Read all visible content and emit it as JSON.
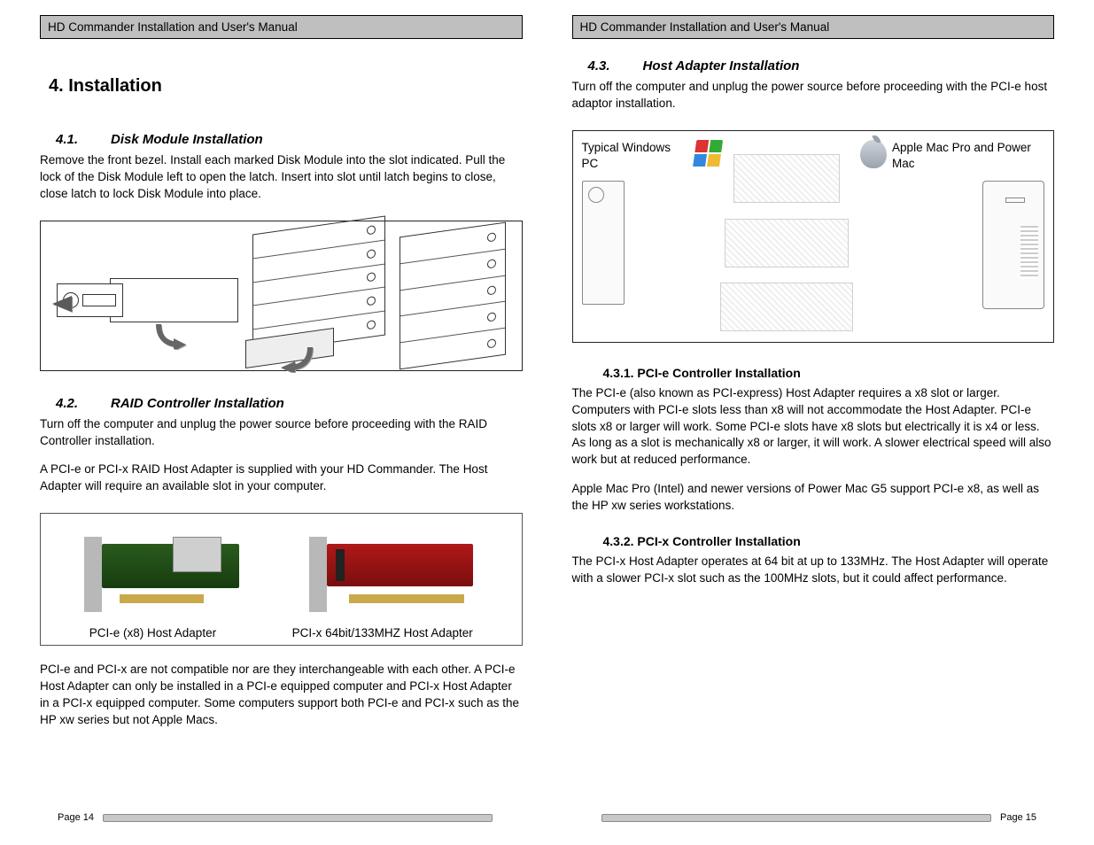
{
  "header_title": "HD Commander Installation and User's Manual",
  "left_page": {
    "section_title": "4. Installation",
    "s41": {
      "num": "4.1.",
      "title": "Disk Module Installation",
      "p1": "Remove the front bezel.  Install each marked Disk Module into the slot indicated.  Pull the lock of the Disk Module left to open the latch.  Insert into slot until latch begins to close, close latch to lock Disk Module into place."
    },
    "s42": {
      "num": "4.2.",
      "title": "RAID Controller Installation",
      "p1": "Turn off the computer and unplug the power source before proceeding with the RAID Controller installation.",
      "p2": "A PCI-e or PCI-x RAID Host Adapter is supplied with your HD Commander.  The Host Adapter will require an available slot in your computer.",
      "label_pcie": "PCI-e (x8) Host Adapter",
      "label_pcix": "PCI-x 64bit/133MHZ Host Adapter",
      "p3": "PCI-e and PCI-x are not compatible nor are they interchangeable with each other.  A PCI-e Host Adapter can only be installed in a PCI-e equipped computer and PCI-x Host Adapter in a PCI-x equipped computer.  Some computers support both PCI-e and PCI-x such as the HP xw series but not Apple Macs."
    },
    "footer": "Page 14"
  },
  "right_page": {
    "s43": {
      "num": "4.3.",
      "title": "Host Adapter Installation",
      "p1": "Turn off the computer and unplug the power source before proceeding with the PCI-e host adaptor installation.",
      "label_win": "Typical Windows PC",
      "label_mac": "Apple Mac Pro and Power Mac"
    },
    "s431": {
      "title": "4.3.1. PCI-e Controller Installation",
      "p1": "The PCI-e (also known as PCI-express) Host Adapter requires a x8 slot or larger.  Computers with PCI-e slots less than x8 will not accommodate the Host Adapter.  PCI-e slots x8 or larger will work.  Some PCI-e slots have x8 slots but electrically it is x4 or less.  As long as a slot is mechanically x8 or larger, it will work.  A slower electrical speed will also work but at reduced performance.",
      "p2": "Apple Mac Pro (Intel) and newer versions of Power Mac G5 support PCI-e x8, as well as the HP xw series workstations."
    },
    "s432": {
      "title": "4.3.2. PCI-x Controller Installation",
      "p1": "The PCI-x Host Adapter operates at 64 bit at up to 133MHz.  The Host Adapter will operate with a slower PCI-x slot such as the 100MHz slots, but it could affect performance."
    },
    "footer": "Page 15"
  }
}
